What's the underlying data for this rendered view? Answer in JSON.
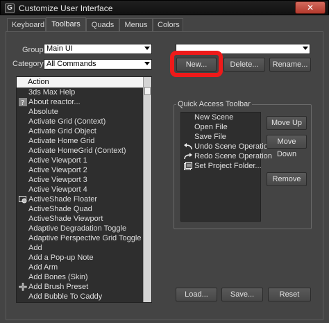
{
  "window": {
    "title": "Customize User Interface",
    "close_label": "✕"
  },
  "tabs": [
    {
      "label": "Keyboard",
      "active": false
    },
    {
      "label": "Toolbars",
      "active": true
    },
    {
      "label": "Quads",
      "active": false
    },
    {
      "label": "Menus",
      "active": false
    },
    {
      "label": "Colors",
      "active": false
    }
  ],
  "filters": {
    "group_label": "Group:",
    "group_value": "Main UI",
    "category_label": "Category:",
    "category_value": "All Commands"
  },
  "toolbar_select": {
    "value": ""
  },
  "toolbar_buttons": {
    "new_label": "New...",
    "delete_label": "Delete...",
    "rename_label": "Rename..."
  },
  "actions_list": {
    "header": "Action",
    "items": [
      {
        "label": "3ds Max Help",
        "icon": ""
      },
      {
        "label": "About reactor...",
        "icon": "help-icon"
      },
      {
        "label": "Absolute",
        "icon": ""
      },
      {
        "label": "Activate Grid (Context)",
        "icon": ""
      },
      {
        "label": "Activate Grid Object",
        "icon": ""
      },
      {
        "label": "Activate Home Grid",
        "icon": ""
      },
      {
        "label": "Activate HomeGrid (Context)",
        "icon": ""
      },
      {
        "label": "Active Viewport 1",
        "icon": ""
      },
      {
        "label": "Active Viewport 2",
        "icon": ""
      },
      {
        "label": "Active Viewport 3",
        "icon": ""
      },
      {
        "label": "Active Viewport 4",
        "icon": ""
      },
      {
        "label": "ActiveShade Floater",
        "icon": "activeshade-icon"
      },
      {
        "label": "ActiveShade Quad",
        "icon": ""
      },
      {
        "label": "ActiveShade Viewport",
        "icon": ""
      },
      {
        "label": "Adaptive Degradation Toggle",
        "icon": ""
      },
      {
        "label": "Adaptive Perspective Grid Toggle",
        "icon": ""
      },
      {
        "label": "Add",
        "icon": ""
      },
      {
        "label": "Add a Pop-up Note",
        "icon": ""
      },
      {
        "label": "Add Arm",
        "icon": ""
      },
      {
        "label": "Add Bones (Skin)",
        "icon": ""
      },
      {
        "label": "Add Brush Preset",
        "icon": "add-brush-icon"
      },
      {
        "label": "Add Bubble To Caddy",
        "icon": ""
      }
    ]
  },
  "quick_access": {
    "title": "Quick Access Toolbar",
    "items": [
      {
        "label": "New Scene",
        "icon": ""
      },
      {
        "label": "Open File",
        "icon": ""
      },
      {
        "label": "Save File",
        "icon": ""
      },
      {
        "label": "Undo Scene Operation",
        "icon": "undo-icon"
      },
      {
        "label": "Redo Scene Operation",
        "icon": "redo-icon"
      },
      {
        "label": "Set Project Folder...",
        "icon": "project-folder-icon"
      }
    ],
    "move_up_label": "Move Up",
    "move_down_label": "Move Down",
    "remove_label": "Remove"
  },
  "bottom_buttons": {
    "load_label": "Load...",
    "save_label": "Save...",
    "reset_label": "Reset"
  },
  "colors": {
    "highlight": "#ee1a1a",
    "close_button": "#c0483b",
    "list_bg": "#2e2e2e"
  }
}
